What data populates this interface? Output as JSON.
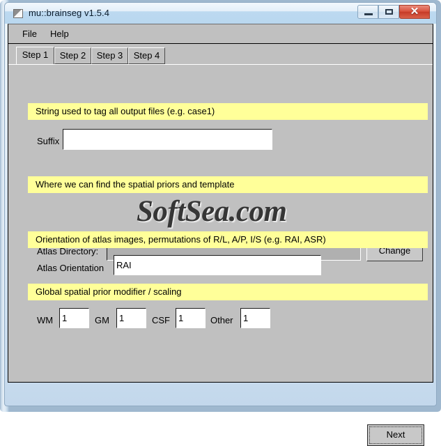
{
  "window": {
    "title": "mu::brainseg v1.5.4",
    "icon": "app-icon",
    "controls": {
      "minimize": "minimize-icon",
      "maximize": "maximize-icon",
      "close": "✕"
    }
  },
  "menubar": {
    "items": [
      {
        "label": "File"
      },
      {
        "label": "Help"
      }
    ]
  },
  "tabs": [
    {
      "label": "Step 1",
      "selected": true
    },
    {
      "label": "Step 2",
      "selected": false
    },
    {
      "label": "Step 3",
      "selected": false
    },
    {
      "label": "Step 4",
      "selected": false
    }
  ],
  "sections": {
    "suffix": {
      "header": "String used to tag all output files (e.g. case1)",
      "label": "Suffix",
      "value": "",
      "placeholder": ""
    },
    "atlas_directory": {
      "header": "Where we can find the spatial priors and template",
      "label": "Atlas Directory:",
      "value": "",
      "placeholder": "",
      "button_label": "Change"
    },
    "atlas_orientation": {
      "header": "Orientation of atlas images, permutations of R/L, A/P, I/S (e.g. RAI, ASR)",
      "label": "Atlas Orientation",
      "value": "RAI",
      "placeholder": ""
    },
    "spatial_prior": {
      "header": "Global spatial prior modifier / scaling",
      "fields": [
        {
          "label": "WM",
          "value": "1"
        },
        {
          "label": "GM",
          "value": "1"
        },
        {
          "label": "CSF",
          "value": "1"
        },
        {
          "label": "Other",
          "value": "1"
        }
      ]
    }
  },
  "footer": {
    "next_label": "Next"
  },
  "watermark": {
    "text": "SoftSea.com"
  },
  "colors": {
    "highlight_yellow": "#ffff99",
    "dialog_gray": "#c0c0c0",
    "close_red": "#c63a27",
    "titlebar_blue": "#b9d7ef"
  }
}
